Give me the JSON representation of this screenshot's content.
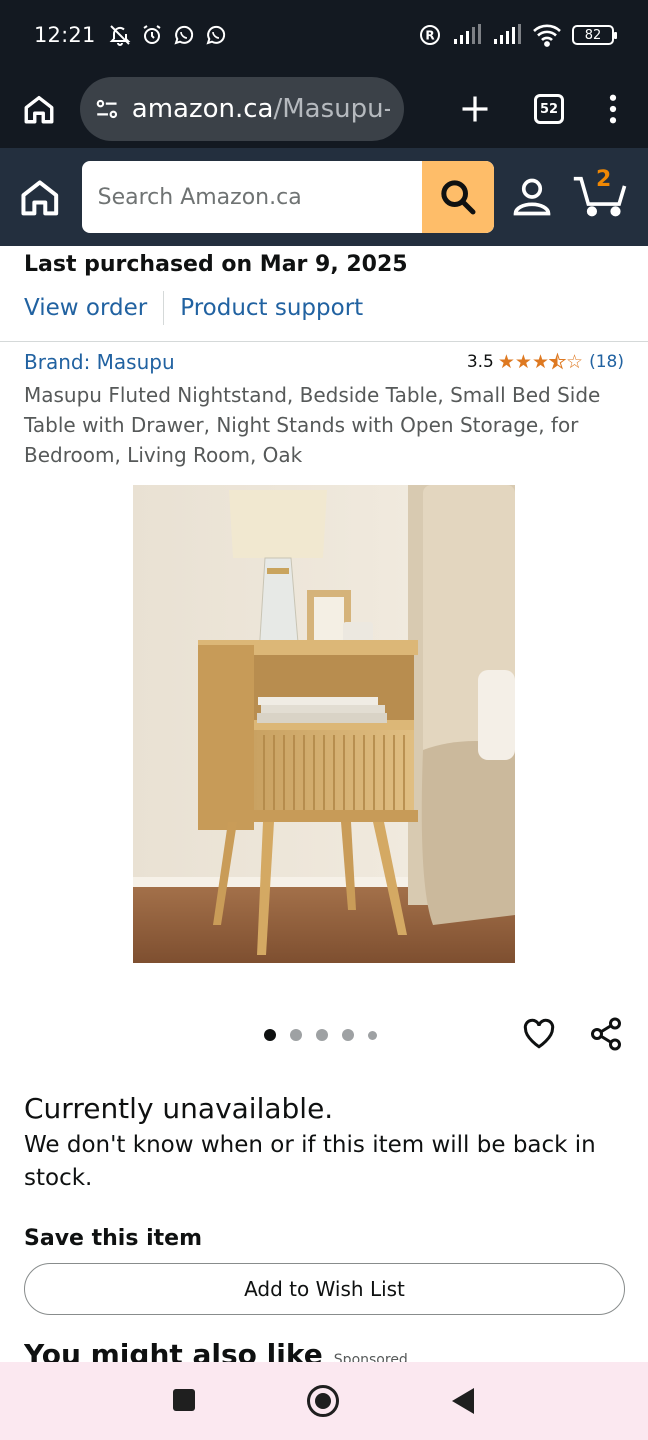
{
  "status_bar": {
    "time": "12:21",
    "battery": "82"
  },
  "browser": {
    "url_domain": "amazon.ca",
    "url_path": "/Masupu-N",
    "tab_count": "52"
  },
  "header": {
    "search_placeholder": "Search Amazon.ca",
    "cart_count": "2",
    "accent_color": "#febd69"
  },
  "purchase": {
    "title": "Last purchased on Mar 9, 2025",
    "view_order": "View order",
    "product_support": "Product support"
  },
  "product": {
    "brand": "Brand: Masupu",
    "rating": "3.5",
    "rating_count": "(18)",
    "title": "Masupu Fluted Nightstand, Bedside Table, Small Bed Side Table with Drawer, Night Stands with Open Storage, for Bedroom, Living Room, Oak",
    "image_count": 5,
    "active_image": 1
  },
  "availability": {
    "title": "Currently unavailable.",
    "description": "We don't know when or if this item will be back in stock."
  },
  "save": {
    "title": "Save this item",
    "wish_list_button": "Add to Wish List"
  },
  "recommendations": {
    "title": "You might also like",
    "sponsored": "Sponsored"
  }
}
